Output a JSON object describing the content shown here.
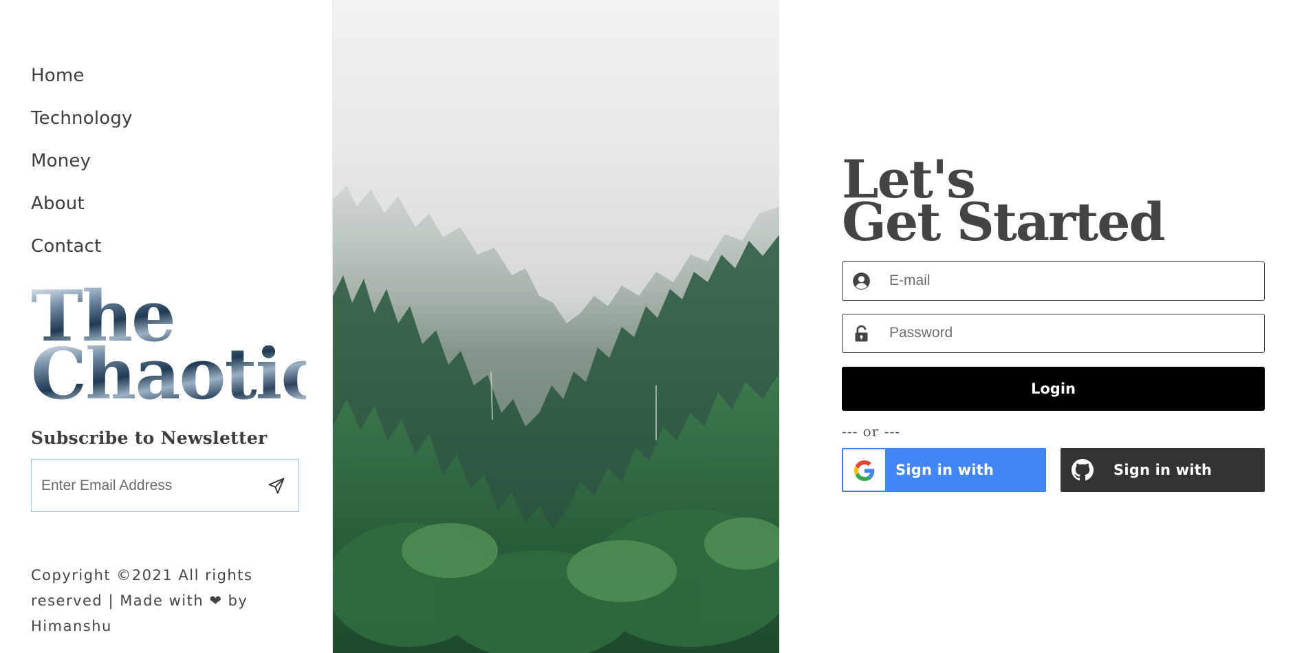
{
  "nav": {
    "items": [
      {
        "label": "Home"
      },
      {
        "label": "Technology"
      },
      {
        "label": "Money"
      },
      {
        "label": "About"
      },
      {
        "label": "Contact"
      }
    ]
  },
  "brand": {
    "line1": "The",
    "line2": "Chaotic"
  },
  "newsletter": {
    "title": "Subscribe to Newsletter",
    "placeholder": "Enter Email Address",
    "send_icon": "send-icon"
  },
  "footer": {
    "copyright": "Copyright ©2021 All rights reserved | Made with ❤ by Himanshu"
  },
  "hero": {
    "image": "misty-forest-photo"
  },
  "login": {
    "headline_line1": "Let's",
    "headline_line2": "Get Started",
    "email_placeholder": "E-mail",
    "password_placeholder": "Password",
    "login_label": "Login",
    "or_text": "--- or ---",
    "google_label": "Sign in with Google",
    "github_label": "Sign in with GitHub"
  },
  "colors": {
    "login_button": "#000000",
    "google_button": "#4285f4",
    "github_button": "#333333",
    "newsletter_border": "#8fcde6",
    "text": "#3d3d3d"
  }
}
